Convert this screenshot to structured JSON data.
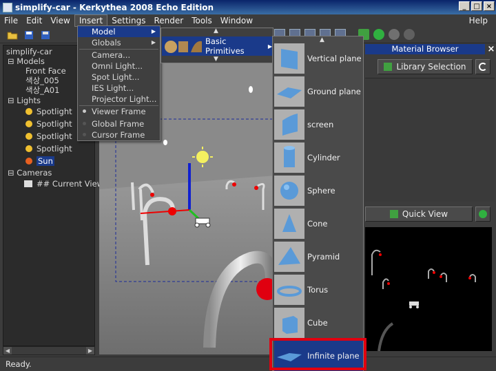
{
  "window": {
    "title": "simplify-car - Kerkythea 2008 Echo Edition",
    "controls": [
      "_",
      "□",
      "×"
    ]
  },
  "menubar": {
    "items": [
      "File",
      "Edit",
      "View",
      "Insert",
      "Settings",
      "Render",
      "Tools",
      "Window"
    ],
    "help": "Help"
  },
  "tree": {
    "root": "simplify-car",
    "models_label": "Models",
    "models": [
      "Front Face",
      "색상_005",
      "색상_A01"
    ],
    "lights_label": "Lights",
    "lights": [
      "Spotlight",
      "Spotlight",
      "Spotlight",
      "Spotlight",
      "Sun"
    ],
    "cameras_label": "Cameras",
    "cameras": [
      "## Current View"
    ]
  },
  "insert_menu": {
    "items": [
      "Model",
      "Globals",
      "Camera...",
      "Omni Light...",
      "Spot Light...",
      "IES Light...",
      "Projector Light...",
      "Viewer Frame",
      "Global Frame",
      "Cursor Frame"
    ]
  },
  "model_submenu": {
    "label": "Basic Primitives"
  },
  "primitives": {
    "items": [
      "Vertical plane",
      "Ground plane",
      "screen",
      "Cylinder",
      "Sphere",
      "Cone",
      "Pyramid",
      "Torus",
      "Cube",
      "Infinite plane"
    ],
    "highlighted": "Infinite plane"
  },
  "right_panel": {
    "header": "Material Browser",
    "library_button": "Library Selection",
    "quickview_button": "Quick View"
  },
  "status": {
    "text": "Ready."
  },
  "colors": {
    "menu_highlight": "#1a3a8a",
    "callout_box": "#e00010",
    "background": "#3c3c3c"
  }
}
